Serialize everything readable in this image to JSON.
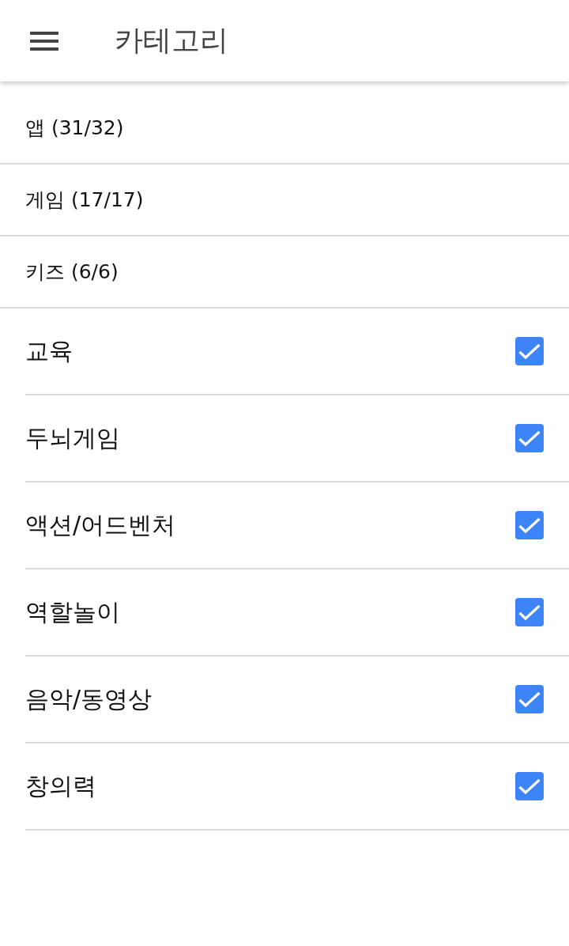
{
  "app_bar": {
    "title": "카테고리"
  },
  "groups": [
    {
      "label": "앱 (31/32)"
    },
    {
      "label": "게임 (17/17)"
    },
    {
      "label": "키즈 (6/6)"
    }
  ],
  "categories": [
    {
      "label": "교육",
      "checked": true
    },
    {
      "label": "두뇌게임",
      "checked": true
    },
    {
      "label": "액션/어드벤처",
      "checked": true
    },
    {
      "label": "역할놀이",
      "checked": true
    },
    {
      "label": "음악/동영상",
      "checked": true
    },
    {
      "label": "창의력",
      "checked": true
    }
  ]
}
